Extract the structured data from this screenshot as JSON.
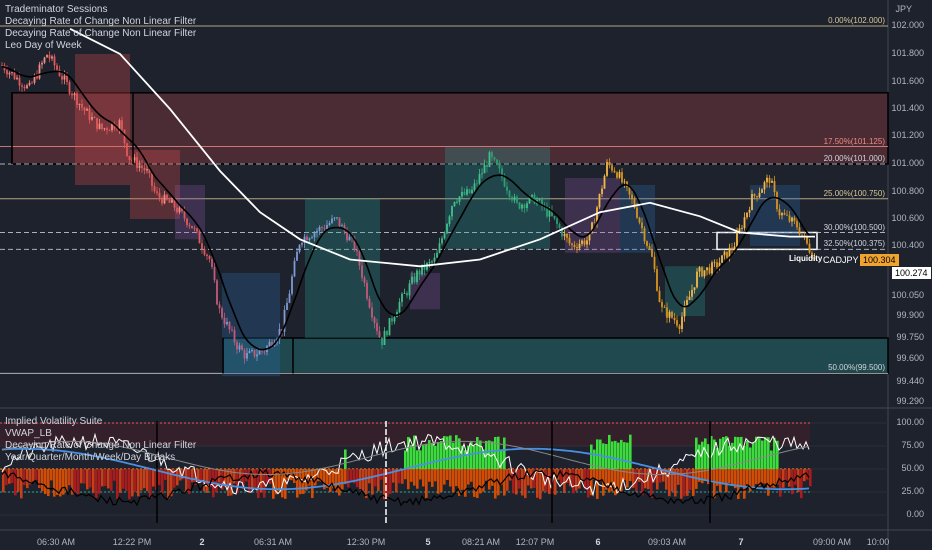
{
  "symbol": {
    "currency": "JPY",
    "ticker": "CADJPY",
    "last_price": "100.304",
    "marker_price": "100.274"
  },
  "colors": {
    "background": "#1e222d",
    "bull": "#26a69a",
    "bear": "#ef5350",
    "orange": "#f0a330",
    "label_bg": "#f0a330"
  },
  "main_legends": [
    "Trademinator Sessions",
    "Decaying Rate of Change Non Linear Filter",
    "Decaying Rate of Change Non Linear Filter",
    "Leo Day of Week"
  ],
  "sub_legends": [
    "Implied Volatility Suite",
    "VWAP_LB",
    "Decaying Rate of Change Non Linear Filter",
    "Year/Quarter/Month/Week/Day Breaks"
  ],
  "price_axis": [
    "102.000",
    "101.800",
    "101.600",
    "101.400",
    "101.200",
    "101.000",
    "100.800",
    "100.600",
    "100.400",
    "100.200",
    "100.050",
    "99.900",
    "99.750",
    "99.600",
    "99.440",
    "99.290"
  ],
  "osc_axis": [
    "100.00",
    "75.00",
    "50.00",
    "25.00",
    "0.00"
  ],
  "time_axis": [
    "06:30 AM",
    "12:22 PM",
    "2",
    "06:31 AM",
    "12:30 PM",
    "5",
    "08:21 AM",
    "12:07 PM",
    "6",
    "09:03 AM",
    "7",
    "09:00 AM",
    "10:00"
  ],
  "fib_levels": [
    {
      "label": "0.00%(102.000)",
      "price": 102.0,
      "color": "#d8c79a"
    },
    {
      "label": "17.50%(101.125)",
      "price": 101.125,
      "color": "#ef8a80"
    },
    {
      "label": "20.00%(101.000)",
      "price": 101.0,
      "color": "#d1d4dc"
    },
    {
      "label": "25.00%(100.750)",
      "price": 100.75,
      "color": "#d8c79a"
    },
    {
      "label": "30.00%(100.500)",
      "price": 100.5,
      "color": "#d1d4dc"
    },
    {
      "label": "32.50%(100.375)",
      "price": 100.375,
      "color": "#d1d4dc"
    },
    {
      "label": "50.00%(99.500)",
      "price": 99.5,
      "color": "#d1d4dc"
    }
  ],
  "annotation": {
    "liquidity": "Liquidity"
  },
  "chart_data": {
    "type": "candlestick",
    "ylim": [
      99.29,
      102.05
    ],
    "price_path": [
      {
        "t": 0,
        "p": 101.72
      },
      {
        "t": 3,
        "p": 101.55
      },
      {
        "t": 5,
        "p": 101.8
      },
      {
        "t": 7,
        "p": 101.6
      },
      {
        "t": 9,
        "p": 101.4
      },
      {
        "t": 11,
        "p": 101.25
      },
      {
        "t": 13,
        "p": 101.3
      },
      {
        "t": 14,
        "p": 101.05
      },
      {
        "t": 16,
        "p": 100.95
      },
      {
        "t": 17,
        "p": 100.78
      },
      {
        "t": 19,
        "p": 100.7
      },
      {
        "t": 21,
        "p": 100.55
      },
      {
        "t": 23,
        "p": 100.3
      },
      {
        "t": 24,
        "p": 99.95
      },
      {
        "t": 26,
        "p": 99.7
      },
      {
        "t": 27,
        "p": 99.62
      },
      {
        "t": 29,
        "p": 99.66
      },
      {
        "t": 31,
        "p": 99.82
      },
      {
        "t": 33,
        "p": 100.45
      },
      {
        "t": 35,
        "p": 100.52
      },
      {
        "t": 37,
        "p": 100.6
      },
      {
        "t": 39,
        "p": 100.4
      },
      {
        "t": 41,
        "p": 99.92
      },
      {
        "t": 42,
        "p": 99.72
      },
      {
        "t": 44,
        "p": 100.0
      },
      {
        "t": 46,
        "p": 100.2
      },
      {
        "t": 48,
        "p": 100.3
      },
      {
        "t": 50,
        "p": 100.75
      },
      {
        "t": 52,
        "p": 100.8
      },
      {
        "t": 54,
        "p": 101.05
      },
      {
        "t": 55,
        "p": 100.95
      },
      {
        "t": 57,
        "p": 100.7
      },
      {
        "t": 59,
        "p": 100.75
      },
      {
        "t": 61,
        "p": 100.6
      },
      {
        "t": 63,
        "p": 100.4
      },
      {
        "t": 65,
        "p": 100.45
      },
      {
        "t": 67,
        "p": 101.0
      },
      {
        "t": 68,
        "p": 100.95
      },
      {
        "t": 70,
        "p": 100.7
      },
      {
        "t": 72,
        "p": 100.3
      },
      {
        "t": 73,
        "p": 99.95
      },
      {
        "t": 75,
        "p": 99.85
      },
      {
        "t": 77,
        "p": 100.2
      },
      {
        "t": 79,
        "p": 100.25
      },
      {
        "t": 81,
        "p": 100.4
      },
      {
        "t": 83,
        "p": 100.75
      },
      {
        "t": 85,
        "p": 100.9
      },
      {
        "t": 86,
        "p": 100.65
      },
      {
        "t": 88,
        "p": 100.55
      },
      {
        "t": 90,
        "p": 100.3
      }
    ],
    "oscillator": {
      "ylim": [
        -5,
        105
      ]
    }
  }
}
